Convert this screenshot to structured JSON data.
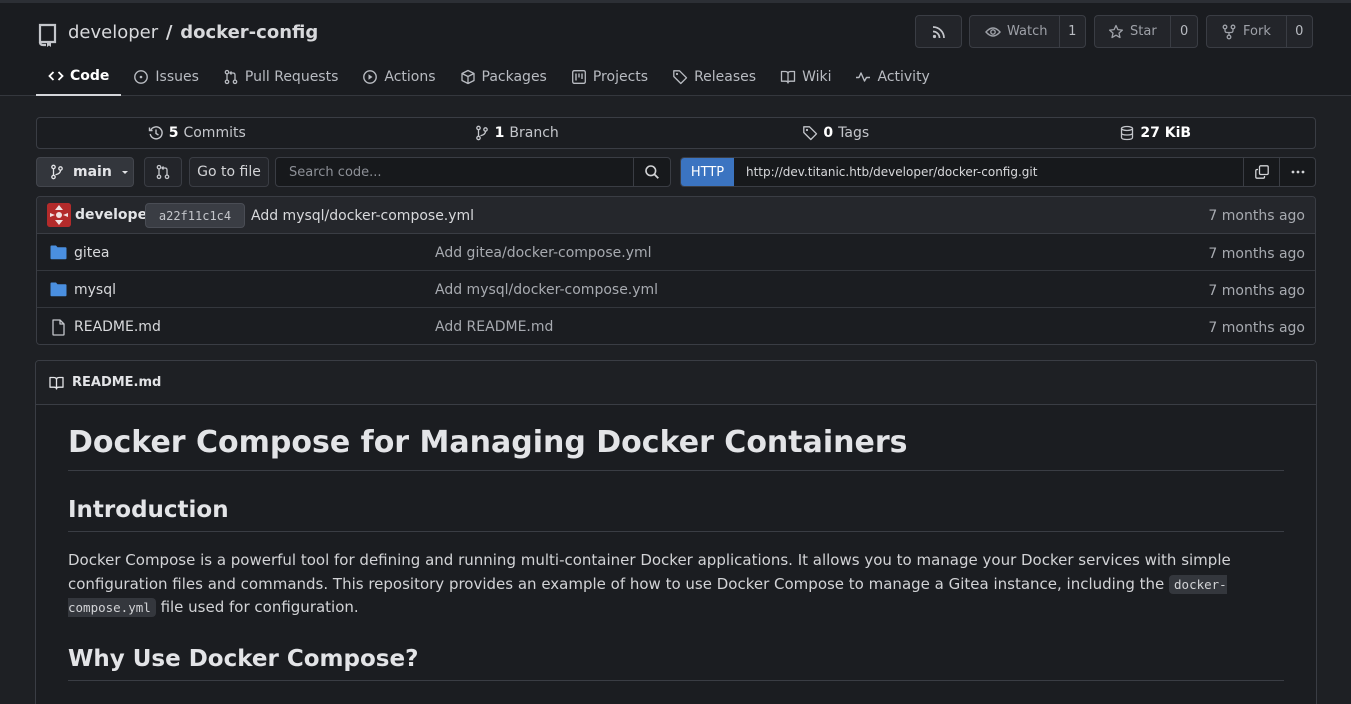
{
  "header": {
    "owner": "developer",
    "separator": "/",
    "repo": "docker-config",
    "watch_label": "Watch",
    "watch_count": "1",
    "star_label": "Star",
    "star_count": "0",
    "fork_label": "Fork",
    "fork_count": "0"
  },
  "tabs": [
    {
      "label": "Code",
      "icon": "code-icon",
      "active": true
    },
    {
      "label": "Issues",
      "icon": "issue-icon"
    },
    {
      "label": "Pull Requests",
      "icon": "pull-request-icon"
    },
    {
      "label": "Actions",
      "icon": "play-icon"
    },
    {
      "label": "Packages",
      "icon": "package-icon"
    },
    {
      "label": "Projects",
      "icon": "project-icon"
    },
    {
      "label": "Releases",
      "icon": "tag-icon"
    },
    {
      "label": "Wiki",
      "icon": "book-icon"
    },
    {
      "label": "Activity",
      "icon": "pulse-icon"
    }
  ],
  "stats": {
    "commits_count": "5",
    "commits_label": "Commits",
    "branch_count": "1",
    "branch_label": "Branch",
    "tags_count": "0",
    "tags_label": "Tags",
    "size": "27 KiB"
  },
  "toolbar": {
    "branch": "main",
    "goto_file": "Go to file",
    "search_placeholder": "Search code...",
    "clone_protocol": "HTTP",
    "clone_url": "http://dev.titanic.htb/developer/docker-config.git"
  },
  "latest_commit": {
    "author": "developer",
    "sha": "a22f11c1c4",
    "message": "Add mysql/docker-compose.yml",
    "time": "7 months ago"
  },
  "files": [
    {
      "name": "gitea",
      "type": "folder",
      "message": "Add gitea/docker-compose.yml",
      "time": "7 months ago"
    },
    {
      "name": "mysql",
      "type": "folder",
      "message": "Add mysql/docker-compose.yml",
      "time": "7 months ago"
    },
    {
      "name": "README.md",
      "type": "file",
      "message": "Add README.md",
      "time": "7 months ago"
    }
  ],
  "readme": {
    "filename": "README.md",
    "h1": "Docker Compose for Managing Docker Containers",
    "h2_intro": "Introduction",
    "intro_before_code": "Docker Compose is a powerful tool for defining and running multi-container Docker applications. It allows you to manage your Docker services with simple configuration files and commands. This repository provides an example of how to use Docker Compose to manage a Gitea instance, including the ",
    "intro_code": "docker-compose.yml",
    "intro_after_code": " file used for configuration.",
    "h2_why": "Why Use Docker Compose?"
  },
  "colors": {
    "background": "#1e2024",
    "accent_blue": "#3b74c1",
    "folder_blue": "#4a8fe0"
  }
}
